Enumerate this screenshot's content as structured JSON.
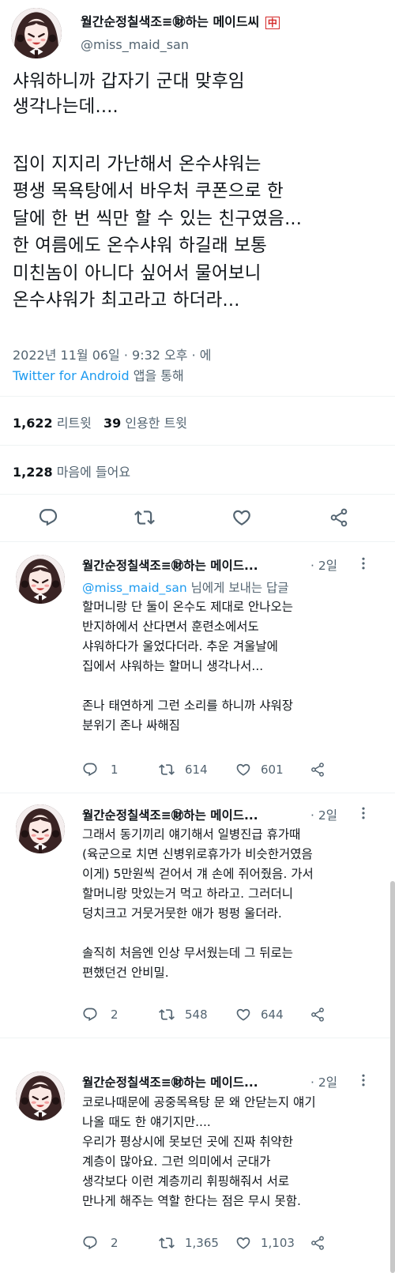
{
  "tweet": {
    "author_name": "월간순정칠색조≡㊖하는 메이드씨",
    "author_badge": "中",
    "handle": "@miss_maid_san",
    "lines": [
      "샤워하니까 갑자기 군대 맞후임",
      "생각나는데....",
      "",
      "집이 지지리 가난해서 온수샤워는",
      "평생 목욕탕에서 바우처 쿠폰으로 한",
      "달에 한 번 씩만 할 수 있는 친구였음...",
      "한 여름에도 온수샤워 하길래 보통",
      "미친놈이 아니다 싶어서 물어보니",
      "온수샤워가 최고라고 하더라..."
    ],
    "timestamp": "2022년 11월 06일 · 9:32 오후 · 에",
    "source": "Twitter for Android",
    "source_suffix": " 앱을 통해",
    "retweets": "1,622",
    "retweets_label": "리트윗",
    "quotes": "39",
    "quotes_label": "인용한 트윗",
    "likes": "1,228",
    "likes_label": "마음에 들어요"
  },
  "replies": [
    {
      "name": "월간순정칠색조≡㊖하는 메이드...",
      "time": "· 2일",
      "reply_to": "@miss_maid_san",
      "reply_to_suffix": " 님에게 보내는 답글",
      "lines": [
        "할머니랑 단 둘이 온수도 제대로 안나오는",
        "반지하에서 산다면서 훈련소에서도",
        "샤워하다가 울었다더라. 추운 겨울날에",
        "집에서 샤워하는 할머니 생각나서...",
        "",
        "존나 태연하게 그런 소리를 하니까 샤워장",
        "분위기 존나 싸해짐"
      ],
      "replies": "1",
      "retweets": "614",
      "likes": "601"
    },
    {
      "name": "월간순정칠색조≡㊖하는 메이드...",
      "time": "· 2일",
      "lines": [
        "그래서 동기끼리 얘기해서 일병진급 휴가때",
        "(육군으로 치면 신병위로휴가가 비슷한거였음",
        "이게) 5만원씩 걷어서 걔 손에 쥐어줬음. 가서",
        "할머니랑 맛있는거 먹고 하라고. 그러더니",
        "덩치크고 거뭇거뭇한 애가 펑펑 울더라.",
        "",
        "솔직히 처음엔 인상 무서웠는데 그 뒤로는",
        "편했던건 안비밀."
      ],
      "replies": "2",
      "retweets": "548",
      "likes": "644"
    },
    {
      "name": "월간순정칠색조≡㊖하는 메이드...",
      "time": "· 2일",
      "lines": [
        "코로나때문에 공중목욕탕 문 왜 안닫는지 얘기",
        "나올 때도 한 얘기지만....",
        "우리가 평상시에 못보던 곳에 진짜 취약한",
        "계층이 많아요. 그런 의미에서 군대가",
        "생각보다 이런 계층끼리 휘핑해줘서 서로",
        "만나게 해주는 역할 한다는 점은 무시 못함."
      ],
      "replies": "2",
      "retweets": "1,365",
      "likes": "1,103"
    }
  ],
  "colors": {
    "text": "#0f1419",
    "muted": "#536471",
    "link": "#1d9bf0",
    "divider": "#eff3f4",
    "badge": "#d42a2a"
  },
  "icons": [
    "reply-icon",
    "retweet-icon",
    "like-icon",
    "share-icon",
    "more-icon"
  ]
}
